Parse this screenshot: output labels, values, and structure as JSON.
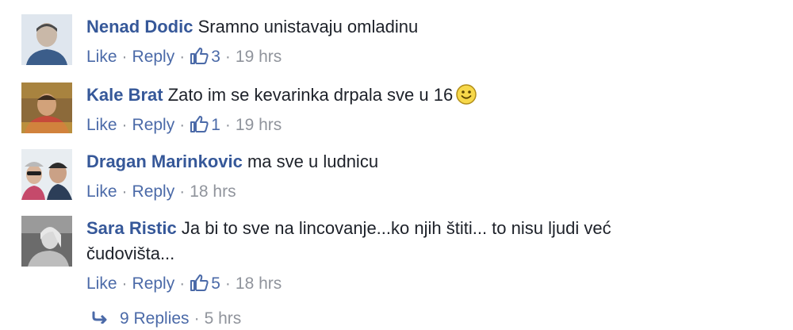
{
  "comments": [
    {
      "author": "Nenad Dodic",
      "text": "Sramno unistavaju omladinu",
      "like_label": "Like",
      "reply_label": "Reply",
      "likes": "3",
      "time": "19 hrs"
    },
    {
      "author": "Kale Brat",
      "text": "Zato im se kevarinka drpala sve u 16",
      "like_label": "Like",
      "reply_label": "Reply",
      "likes": "1",
      "time": "19 hrs"
    },
    {
      "author": "Dragan Marinkovic",
      "text": "ma sve u ludnicu",
      "like_label": "Like",
      "reply_label": "Reply",
      "time": "18 hrs"
    },
    {
      "author": "Sara Ristic",
      "text_line1": "Ja bi to sve na lincovanje...ko njih štiti... to nisu ljudi već",
      "text_line2": "čudovišta...",
      "like_label": "Like",
      "reply_label": "Reply",
      "likes": "5",
      "time": "18 hrs"
    }
  ],
  "replies": {
    "label": "9 Replies",
    "time": "5 hrs"
  },
  "icons": {
    "like": "thumbs-up-icon",
    "emoji": "smiley-icon",
    "reply": "reply-arrow-icon"
  },
  "colors": {
    "author": "#365899",
    "link": "#4b6aa8",
    "meta": "#90949c",
    "text": "#1d2129"
  }
}
